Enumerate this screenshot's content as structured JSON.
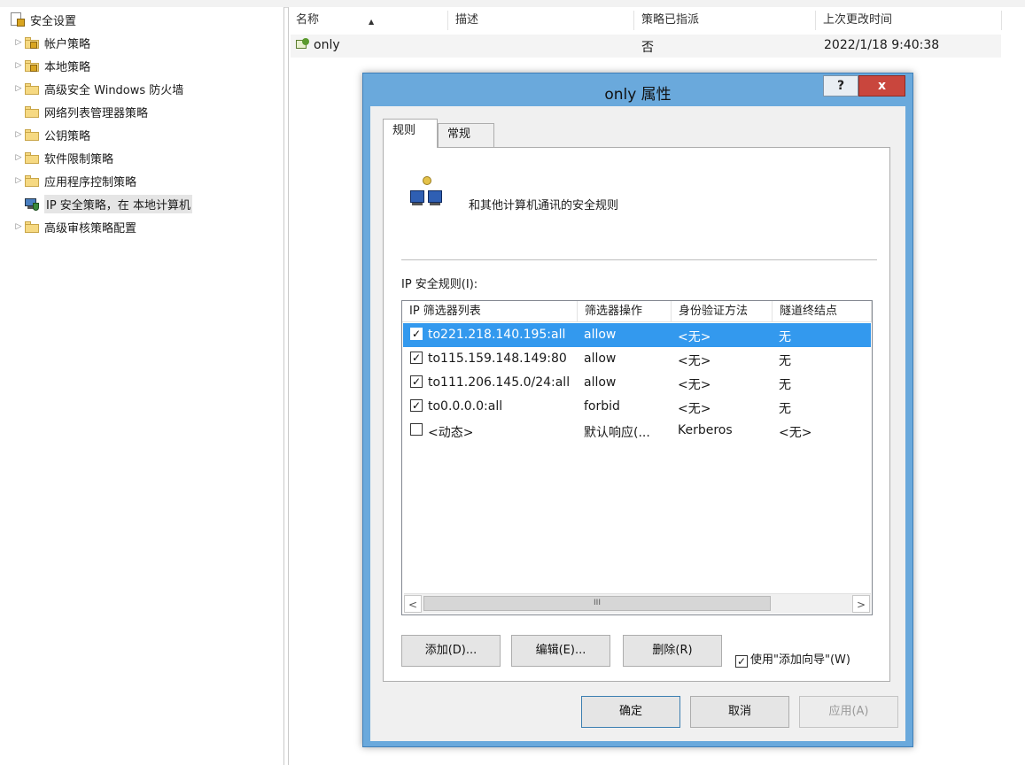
{
  "tree": {
    "root": "安全设置",
    "items": [
      {
        "label": "帐户策略",
        "expandable": true,
        "icon": "locked-folder-icon"
      },
      {
        "label": "本地策略",
        "expandable": true,
        "icon": "locked-folder-icon"
      },
      {
        "label": "高级安全 Windows 防火墙",
        "expandable": true,
        "icon": "folder-icon"
      },
      {
        "label": "网络列表管理器策略",
        "expandable": false,
        "icon": "folder-icon"
      },
      {
        "label": "公钥策略",
        "expandable": true,
        "icon": "folder-icon"
      },
      {
        "label": "软件限制策略",
        "expandable": true,
        "icon": "folder-icon"
      },
      {
        "label": "应用程序控制策略",
        "expandable": true,
        "icon": "folder-icon"
      },
      {
        "label": "IP 安全策略，在 本地计算机",
        "expandable": false,
        "icon": "ip-security-icon",
        "selected": true
      },
      {
        "label": "高级审核策略配置",
        "expandable": true,
        "icon": "folder-icon"
      }
    ]
  },
  "list": {
    "headers": {
      "name": "名称",
      "desc": "描述",
      "assigned": "策略已指派",
      "modified": "上次更改时间"
    },
    "rows": [
      {
        "name": "only",
        "desc": "",
        "assigned": "否",
        "modified": "2022/1/18 9:40:38"
      }
    ]
  },
  "dialog": {
    "title": "only 属性",
    "help": "?",
    "close": "x",
    "tabs": {
      "rules": "规则",
      "general": "常规"
    },
    "description": "和其他计算机通讯的安全规则",
    "rules_label": "IP 安全规则(I):",
    "columns": {
      "filter": "IP 筛选器列表",
      "action": "筛选器操作",
      "auth": "身份验证方法",
      "tunnel": "隧道终结点"
    },
    "rules": [
      {
        "checked": true,
        "filter": "to221.218.140.195:all",
        "action": "allow",
        "auth": "<无>",
        "tunnel": "无",
        "selected": true
      },
      {
        "checked": true,
        "filter": "to115.159.148.149:80",
        "action": "allow",
        "auth": "<无>",
        "tunnel": "无"
      },
      {
        "checked": true,
        "filter": "to111.206.145.0/24:all",
        "action": "allow",
        "auth": "<无>",
        "tunnel": "无"
      },
      {
        "checked": true,
        "filter": "to0.0.0.0:all",
        "action": "forbid",
        "auth": "<无>",
        "tunnel": "无"
      },
      {
        "checked": false,
        "filter": "<动态>",
        "action": "默认响应(...",
        "auth": "Kerberos",
        "tunnel": "<无>"
      }
    ],
    "scroll": {
      "left": "<",
      "thumb": "III",
      "right": ">"
    },
    "buttons": {
      "add": "添加(D)...",
      "edit": "编辑(E)...",
      "remove": "删除(R)"
    },
    "wizard": {
      "checked": true,
      "label": "使用\"添加向导\"(W)"
    },
    "footer": {
      "ok": "确定",
      "cancel": "取消",
      "apply": "应用(A)"
    },
    "colors": {
      "titlebar": "#6aa9dc",
      "selection": "#3399ee",
      "close": "#c9463d"
    }
  }
}
